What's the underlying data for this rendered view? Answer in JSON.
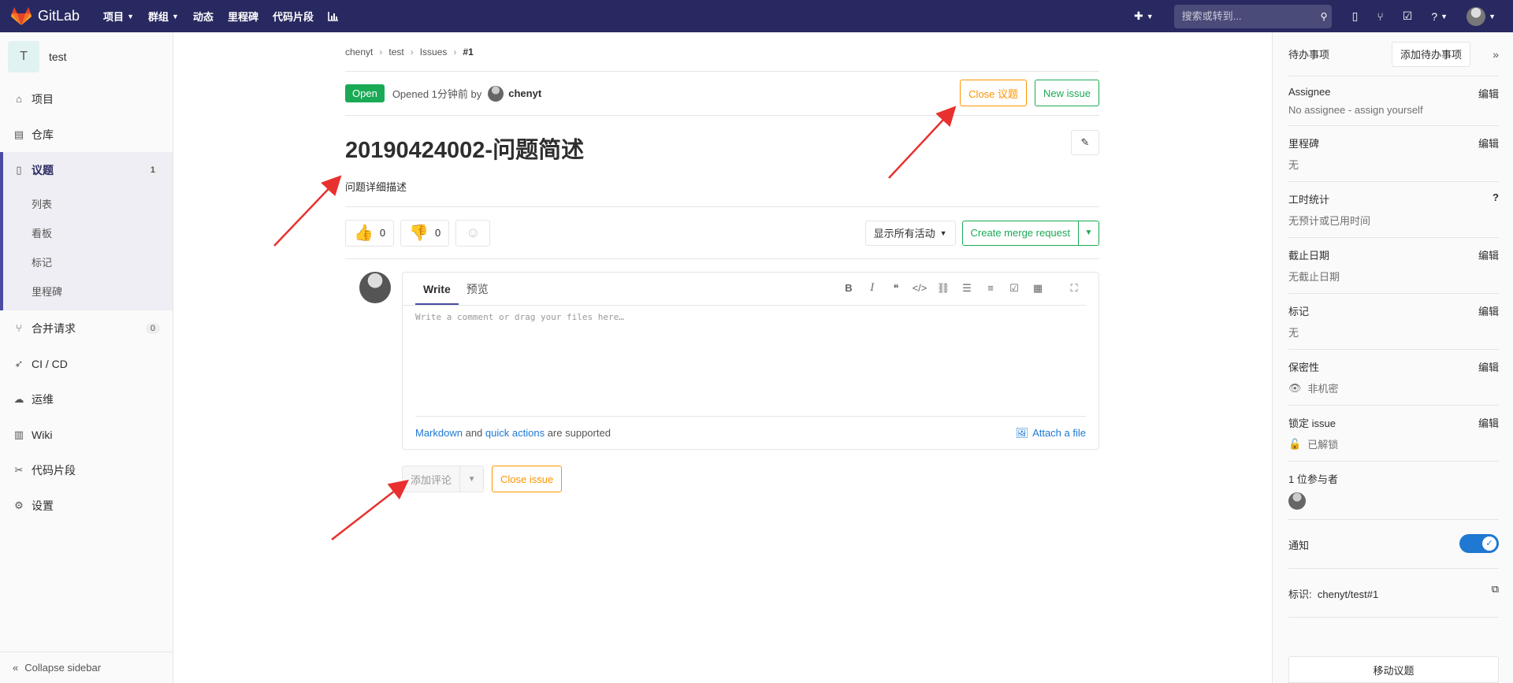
{
  "navbar": {
    "logo_text": "GitLab",
    "items": [
      {
        "label": "项目",
        "caret": true
      },
      {
        "label": "群组",
        "caret": true
      },
      {
        "label": "动态",
        "caret": false
      },
      {
        "label": "里程碑",
        "caret": false
      },
      {
        "label": "代码片段",
        "caret": false
      }
    ],
    "search_placeholder": "搜索或转到..."
  },
  "sidebar": {
    "project_initial": "T",
    "project_name": "test",
    "items": [
      {
        "label": "项目",
        "icon": "home-icon"
      },
      {
        "label": "仓库",
        "icon": "repo-icon"
      },
      {
        "label": "议题",
        "icon": "issues-icon",
        "count": "1"
      },
      {
        "label": "合并请求",
        "icon": "merge-request-icon",
        "count": "0"
      },
      {
        "label": "CI / CD",
        "icon": "rocket-icon"
      },
      {
        "label": "运维",
        "icon": "operations-icon"
      },
      {
        "label": "Wiki",
        "icon": "book-icon"
      },
      {
        "label": "代码片段",
        "icon": "snippet-icon"
      },
      {
        "label": "设置",
        "icon": "gear-icon"
      }
    ],
    "sub_items": [
      "列表",
      "看板",
      "标记",
      "里程碑"
    ],
    "collapse_label": "Collapse sidebar"
  },
  "breadcrumb": [
    "chenyt",
    "test",
    "Issues",
    "#1"
  ],
  "issue": {
    "status": "Open",
    "opened_text": "Opened 1分钟前 by",
    "author": "chenyt",
    "close_button": "Close 议题",
    "new_button": "New issue",
    "title": "20190424002-问题简述",
    "description": "问题详细描述",
    "thumbs_up_count": "0",
    "thumbs_down_count": "0",
    "activity_filter": "显示所有活动",
    "merge_request_button": "Create merge request"
  },
  "comment": {
    "tab_write": "Write",
    "tab_preview": "预览",
    "placeholder": "Write a comment or drag your files here…",
    "markdown_link": "Markdown",
    "and_text": "and",
    "quick_actions_link": "quick actions",
    "supported_text": "are supported",
    "attach_label": "Attach a file",
    "add_comment_button": "添加评论",
    "close_issue_button": "Close issue"
  },
  "right_sidebar": {
    "todo_label": "待办事项",
    "add_todo_button": "添加待办事项",
    "edit_label": "编辑",
    "assignee_title": "Assignee",
    "assignee_value": "No assignee - ",
    "assign_yourself": "assign yourself",
    "milestone_title": "里程碑",
    "milestone_value": "无",
    "time_title": "工时统计",
    "time_value": "无预计或已用时间",
    "due_title": "截止日期",
    "due_value": "无截止日期",
    "labels_title": "标记",
    "labels_value": "无",
    "confidential_title": "保密性",
    "confidential_value": "非机密",
    "lock_title": "锁定 issue",
    "lock_value": "已解锁",
    "participants_title": "1 位参与者",
    "notify_title": "通知",
    "reference_label": "标识:",
    "reference_value": "chenyt/test#1",
    "move_button": "移动议题"
  },
  "colors": {
    "navbar": "#292961",
    "open_badge": "#1aaa55",
    "warning": "#fc9403",
    "arrow": "#e8312f"
  }
}
